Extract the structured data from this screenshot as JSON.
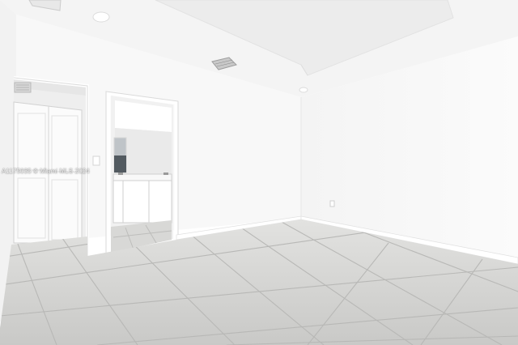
{
  "watermark": {
    "text": "A1175035 © Miami MLS 2024"
  },
  "colors": {
    "wall": "#f7f7f7",
    "ceiling": "#f3f3f3",
    "floor_tile": "#d3d3d1",
    "grout": "#b7b7b5",
    "trim": "#ffffff"
  }
}
